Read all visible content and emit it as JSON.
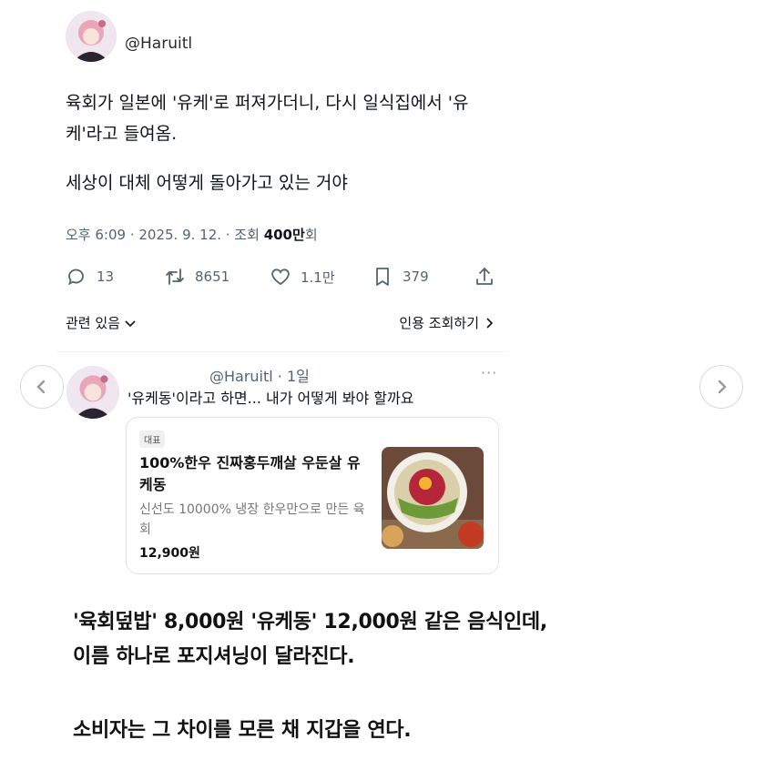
{
  "tweet": {
    "handle": "@Haruitl",
    "text_line1": "육회가 일본에 '유케'로 퍼져가더니, 다시 일식집에서 '유",
    "text_line2": "케'라고 들여옴.",
    "text_line3": "세상이 대체 어떻게 돌아가고 있는 거야",
    "meta_time": "오후 6:09 · 2025. 9. 12. · 조회 ",
    "meta_views": "400만",
    "meta_suffix": "회",
    "replies": "13",
    "retweets": "8651",
    "likes": "1.1만",
    "bookmarks": "379",
    "related_label": "관련 있음",
    "quotes_label": "인용 조회하기"
  },
  "reply": {
    "handle": "@Haruitl · 1일",
    "more": "···",
    "text": "'유케동'이라고 하면... 내가 어떻게 봐야 할까요"
  },
  "card": {
    "tag": "대표",
    "title": "100%한우 진짜홍두깨살 우둔살 유케동",
    "description": "신선도 10000% 냉장 한우만으로 만든 육회",
    "price": "12,900원"
  },
  "caption": {
    "line1": "'육회덮밥' 8,000원 '유케동' 12,000원 같은 음식인데,",
    "line2": "이름 하나로 포지셔닝이 달라진다.",
    "line3": "소비자는 그 차이를 모른 채 지갑을 연다."
  },
  "colors": {
    "secondary_text": "#536471",
    "divider": "#eff3f4"
  },
  "icons": [
    "reply-icon",
    "retweet-icon",
    "like-icon",
    "bookmark-icon",
    "share-icon",
    "chevron-down-icon",
    "chevron-right-icon",
    "chevron-left-icon",
    "more-icon"
  ]
}
